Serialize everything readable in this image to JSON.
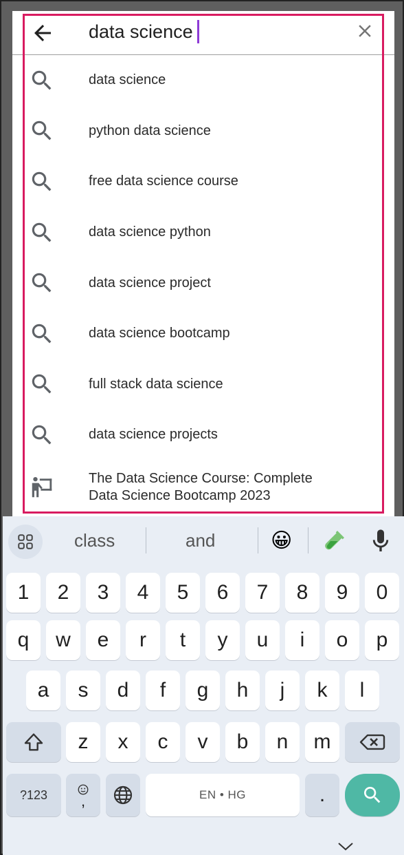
{
  "search": {
    "query": "data science"
  },
  "suggestions": [
    {
      "label": "data science",
      "icon": "search-icon"
    },
    {
      "label": "python data science",
      "icon": "search-icon"
    },
    {
      "label": "free data science course",
      "icon": "search-icon"
    },
    {
      "label": "data science python",
      "icon": "search-icon"
    },
    {
      "label": "data science project",
      "icon": "search-icon"
    },
    {
      "label": "data science bootcamp",
      "icon": "search-icon"
    },
    {
      "label": "full stack data science",
      "icon": "search-icon"
    },
    {
      "label": "data science projects",
      "icon": "search-icon"
    },
    {
      "line1": "The Data Science Course: Complete",
      "line2": "Data Science Bootcamp 2023",
      "icon": "course-icon"
    }
  ],
  "keyboard": {
    "suggestion_strip": {
      "word1": "class",
      "word2": "and",
      "emoji": "😀"
    },
    "row_numbers": [
      "1",
      "2",
      "3",
      "4",
      "5",
      "6",
      "7",
      "8",
      "9",
      "0"
    ],
    "row1": [
      "q",
      "w",
      "e",
      "r",
      "t",
      "y",
      "u",
      "i",
      "o",
      "p"
    ],
    "row2": [
      "a",
      "s",
      "d",
      "f",
      "g",
      "h",
      "j",
      "k",
      "l"
    ],
    "row3": [
      "z",
      "x",
      "c",
      "v",
      "b",
      "n",
      "m"
    ],
    "symbols_label": "?123",
    "emoji_comma": ",",
    "space_label": "EN • HG",
    "period": "."
  },
  "colors": {
    "highlight": "#d81b60",
    "caret": "#8e3bd6",
    "search_key": "#4fb8a5",
    "keyboard_bg": "#e9eef5"
  }
}
